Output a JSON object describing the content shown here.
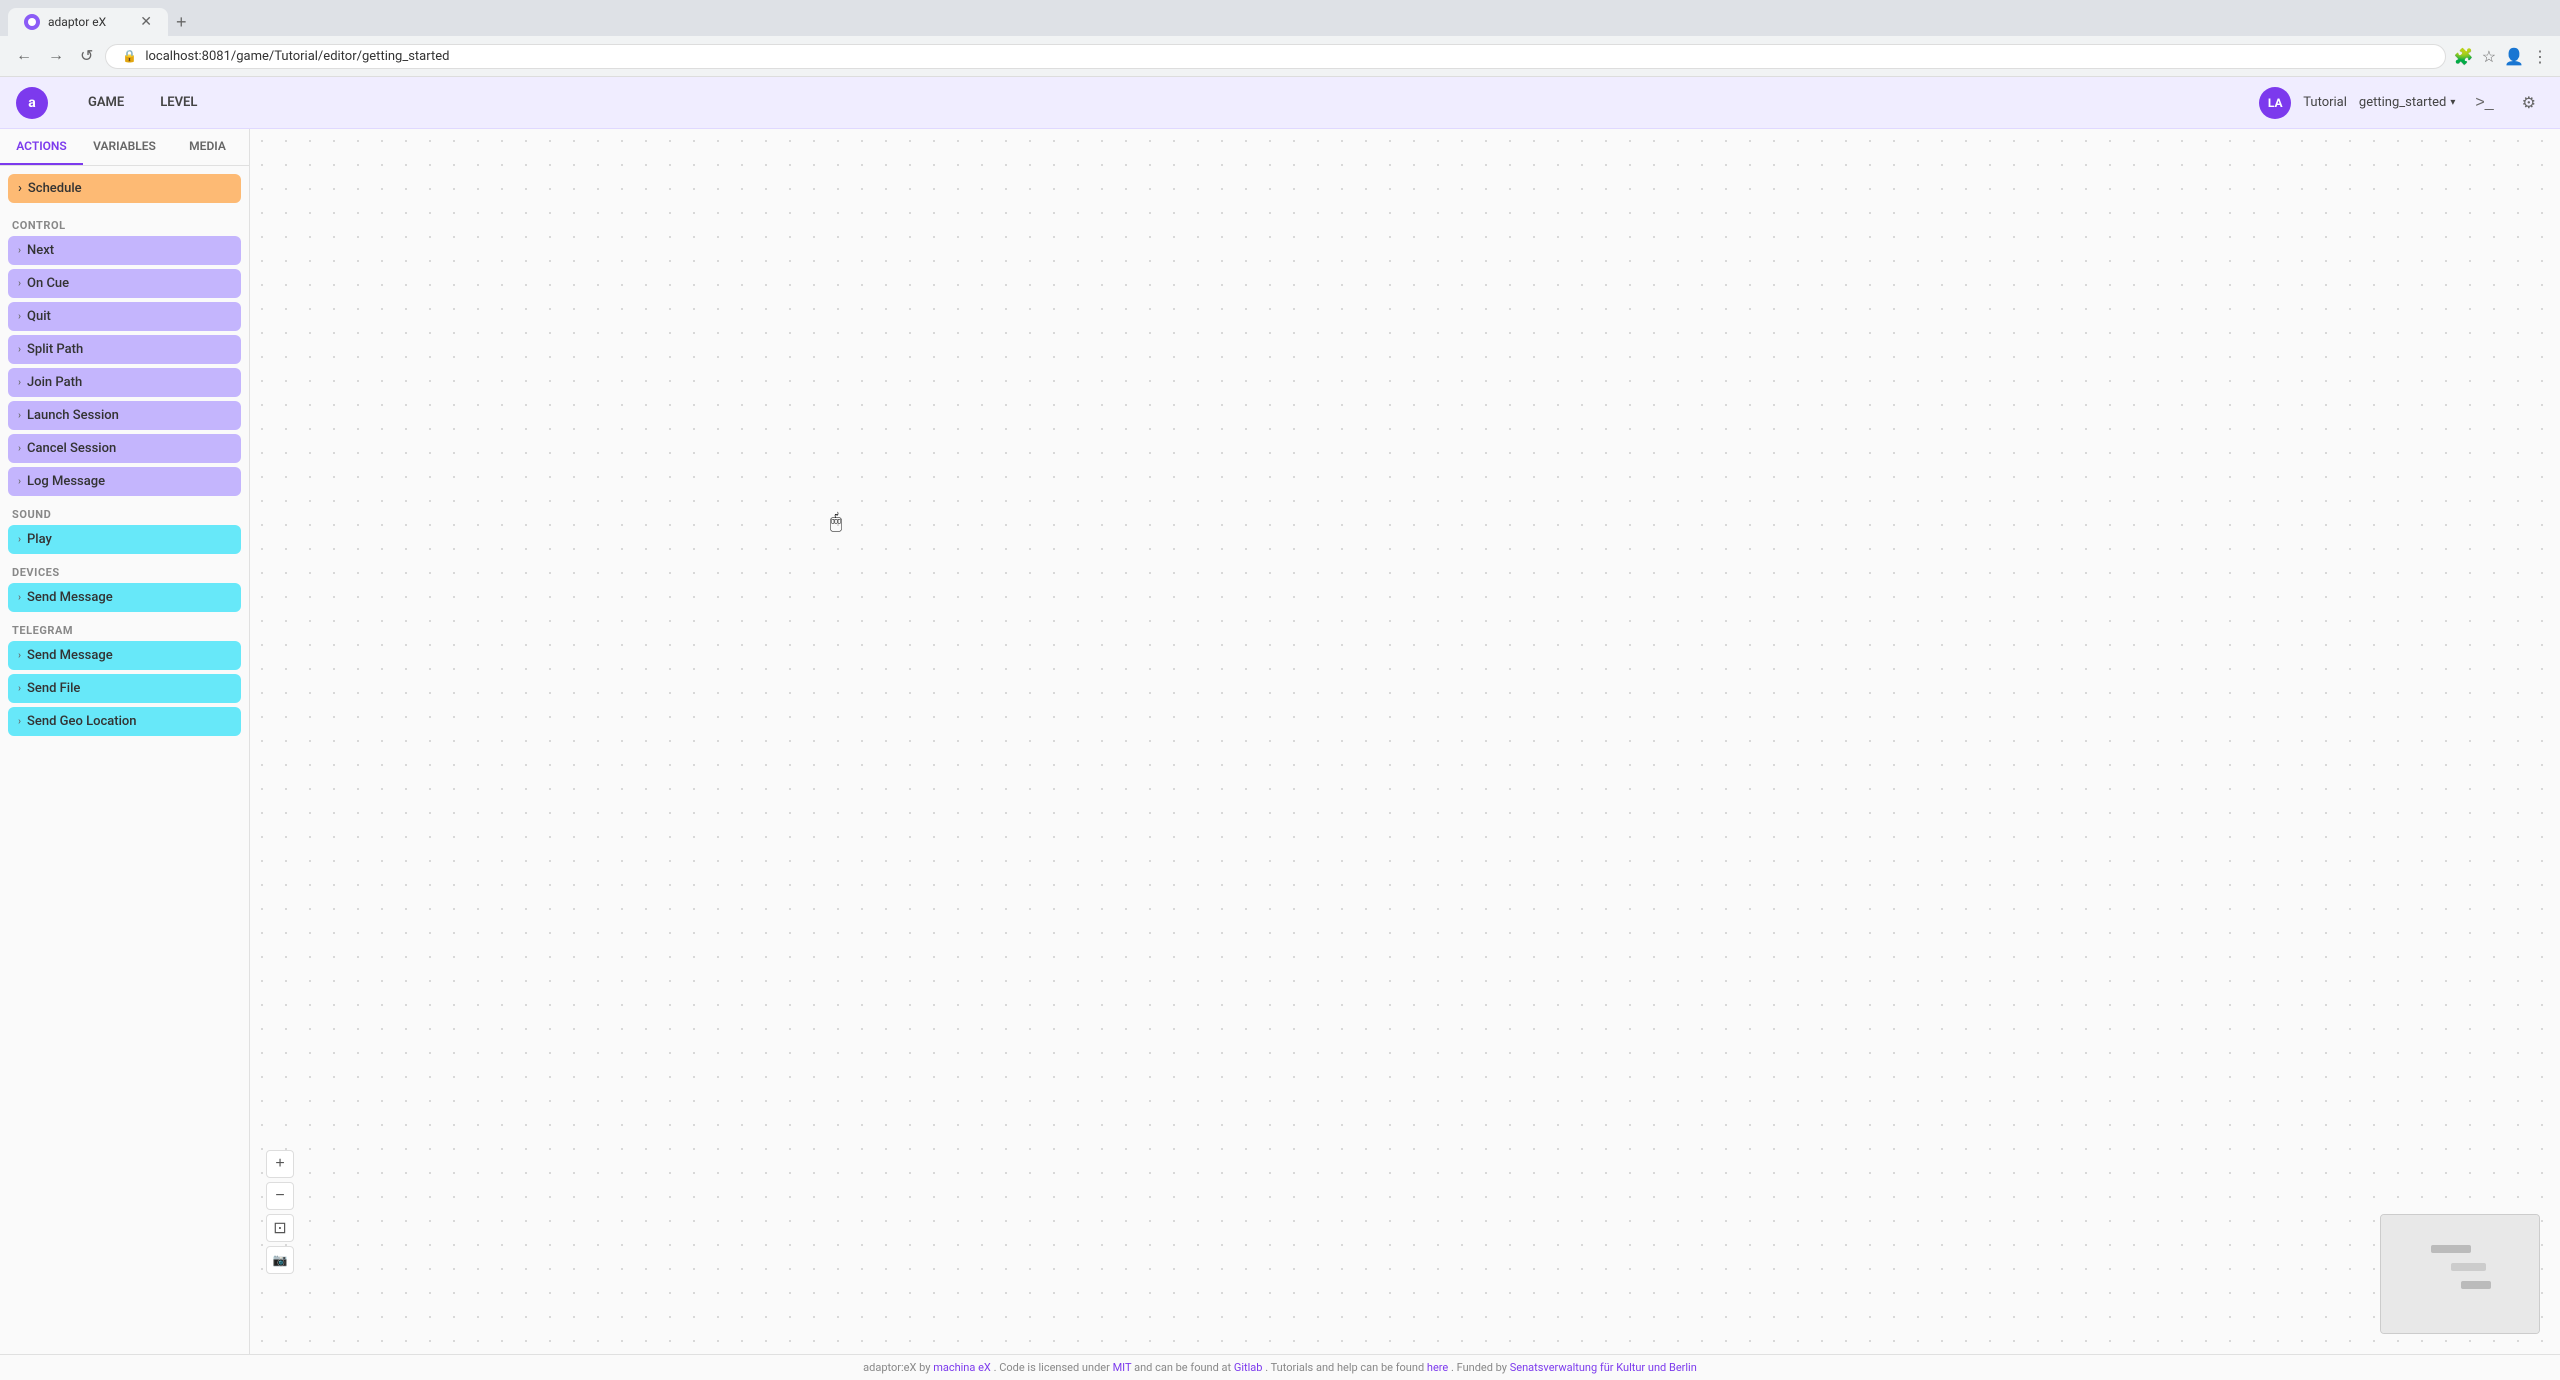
{
  "browser": {
    "tab_title": "adaptor eX",
    "url": "localhost:8081/game/Tutorial/editor/getting_started",
    "nav_back": "←",
    "nav_forward": "→",
    "nav_refresh": "↺"
  },
  "header": {
    "logo_text": "a",
    "nav_items": [
      "GAME",
      "LEVEL"
    ],
    "avatar_text": "LA",
    "project_name": "Tutorial",
    "level_name": "getting_started",
    "terminal_icon": ">_",
    "settings_icon": "⚙"
  },
  "sidebar": {
    "tabs": [
      "ACTIONS",
      "VARIABLES",
      "MEDIA"
    ],
    "active_tab": "ACTIONS",
    "schedule_item": "Schedule",
    "sections": [
      {
        "label": "CONTROL",
        "items": [
          {
            "label": "Next",
            "color": "purple"
          },
          {
            "label": "On Cue",
            "color": "purple"
          },
          {
            "label": "Quit",
            "color": "purple"
          },
          {
            "label": "Split Path",
            "color": "purple"
          },
          {
            "label": "Join Path",
            "color": "purple"
          },
          {
            "label": "Launch Session",
            "color": "purple"
          },
          {
            "label": "Cancel Session",
            "color": "purple"
          },
          {
            "label": "Log Message",
            "color": "purple"
          }
        ]
      },
      {
        "label": "SOUND",
        "items": [
          {
            "label": "Play",
            "color": "teal"
          }
        ]
      },
      {
        "label": "DEVICES",
        "items": [
          {
            "label": "Send Message",
            "color": "teal"
          }
        ]
      },
      {
        "label": "TELEGRAM",
        "items": [
          {
            "label": "Send Message",
            "color": "teal"
          },
          {
            "label": "Send File",
            "color": "teal"
          },
          {
            "label": "Send Geo Location",
            "color": "teal"
          }
        ]
      }
    ]
  },
  "canvas": {
    "zoom_in": "+",
    "zoom_out": "−",
    "fit": "⊡",
    "screenshot": "📷"
  },
  "footer": {
    "text": "adaptor:eX by",
    "machina_link": "machina eX",
    "license_text": ". Code is licensed under",
    "mit_link": "MIT",
    "gitlab_text": "and can be found at",
    "gitlab_link": "Gitlab",
    "tutorials_text": ". Tutorials and help can be found",
    "here_link": "here",
    "funded_text": ". Funded by",
    "senat_link": "Senatsverwaltung für Kultur und Berlin"
  }
}
